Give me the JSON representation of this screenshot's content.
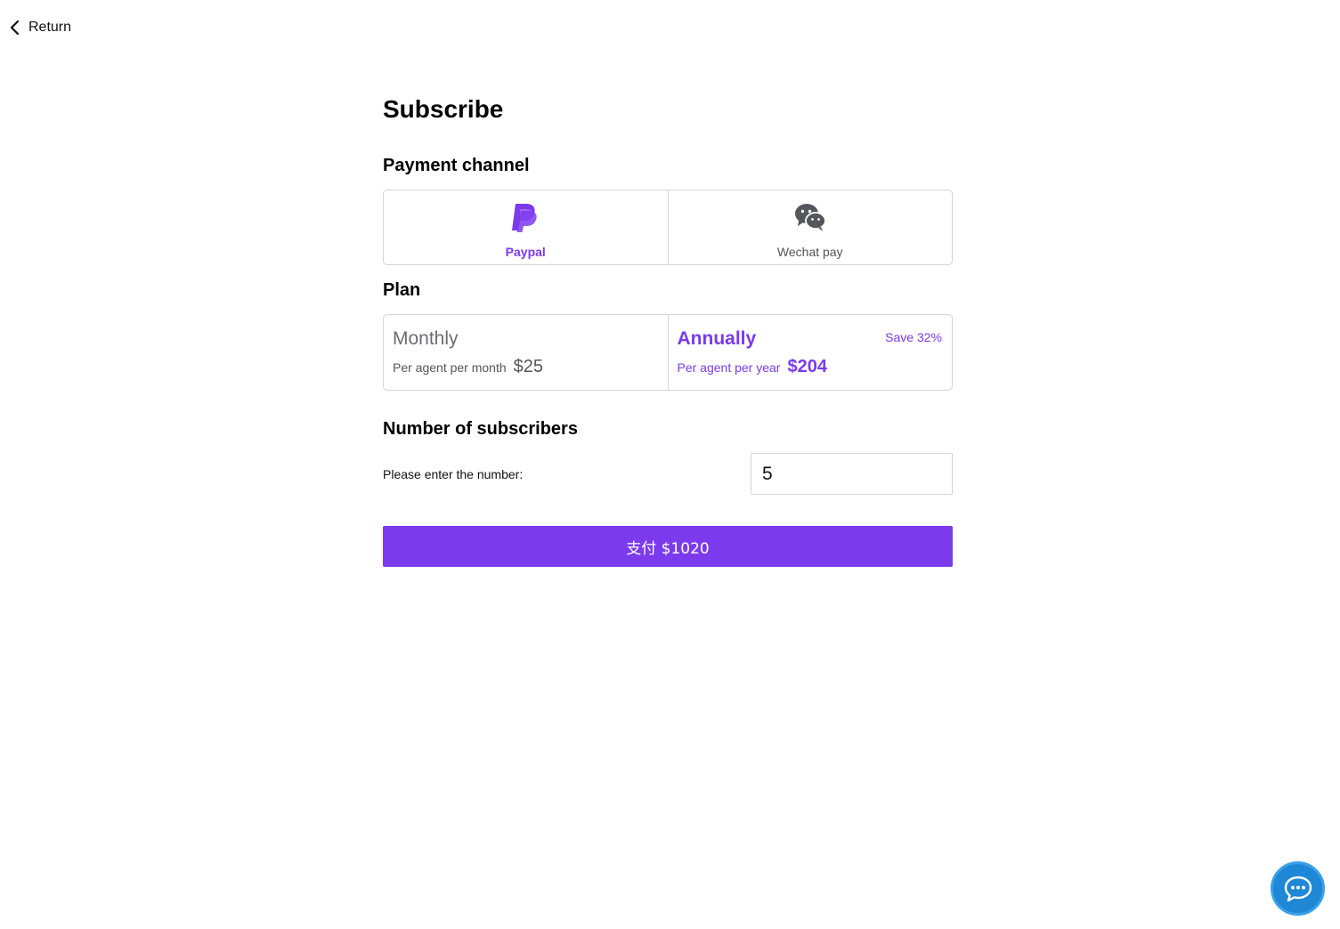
{
  "nav": {
    "return_label": "Return"
  },
  "page": {
    "title": "Subscribe"
  },
  "payment": {
    "title": "Payment channel",
    "channels": [
      {
        "label": "Paypal",
        "icon": "paypal-icon",
        "selected": true
      },
      {
        "label": "Wechat pay",
        "icon": "wechat-icon",
        "selected": false
      }
    ]
  },
  "plan": {
    "title": "Plan",
    "options": [
      {
        "name": "Monthly",
        "desc": "Per agent per month",
        "price": "$25",
        "selected": false
      },
      {
        "name": "Annually",
        "desc": "Per agent per year",
        "price": "$204",
        "badge": "Save 32%",
        "selected": true
      }
    ]
  },
  "subscribers": {
    "title": "Number of subscribers",
    "prompt": "Please enter the number:",
    "value": "5"
  },
  "pay_button": {
    "label": "支付 $1020"
  },
  "colors": {
    "accent": "#7c3aed",
    "chat": "#1e88d6",
    "border": "#d4d4d8"
  },
  "chat_widget": {
    "icon": "chat-bubble-icon"
  }
}
